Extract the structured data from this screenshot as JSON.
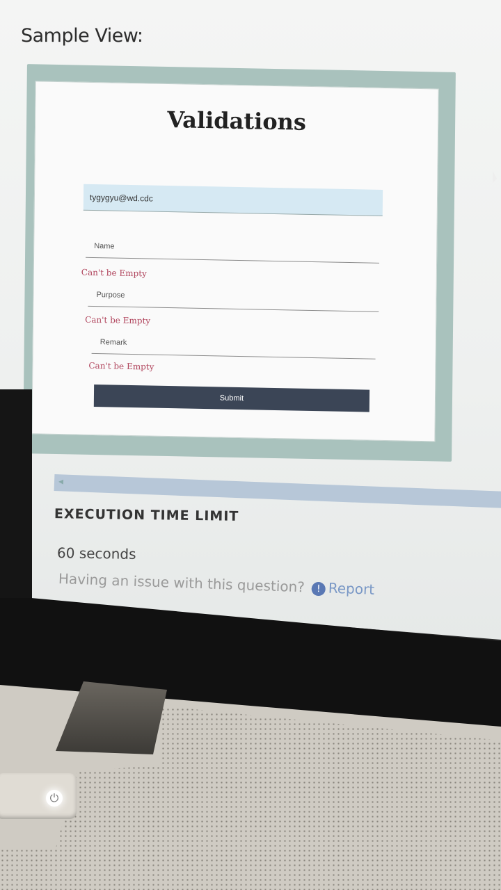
{
  "page": {
    "sample_label": "Sample View:"
  },
  "form": {
    "title": "Validations",
    "email_value": "tygygyu@wd.cdc",
    "name_placeholder": "Name",
    "name_error": "Can't be Empty",
    "purpose_placeholder": "Purpose",
    "purpose_error": "Can't be Empty",
    "remark_placeholder": "Remark",
    "remark_error": "Can't be Empty",
    "submit_label": "Submit"
  },
  "details": {
    "heading": "EXECUTION TIME LIMIT",
    "time_value": "60 seconds",
    "issue_text": "Having an issue with this question?",
    "report_label": "Report",
    "info_icon": "!"
  },
  "colors": {
    "frame": "#a9c2bd",
    "input_fill": "#d6e9f3",
    "error": "#b0445c",
    "submit_bg": "#3b4556",
    "report_link": "#7a98c6"
  }
}
